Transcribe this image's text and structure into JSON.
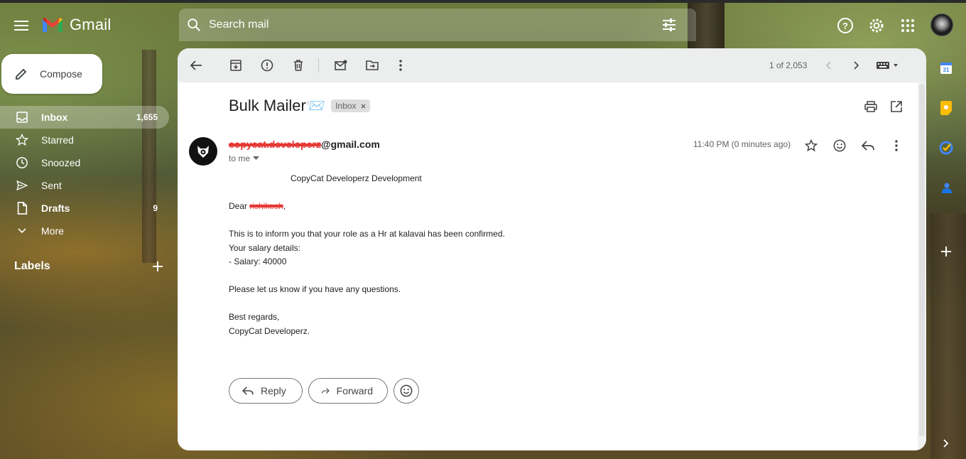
{
  "app": {
    "name": "Gmail"
  },
  "search": {
    "placeholder": "Search mail"
  },
  "sidebar": {
    "compose_label": "Compose",
    "items": [
      {
        "label": "Inbox",
        "count": "1,655"
      },
      {
        "label": "Starred",
        "count": ""
      },
      {
        "label": "Snoozed",
        "count": ""
      },
      {
        "label": "Sent",
        "count": ""
      },
      {
        "label": "Drafts",
        "count": "9"
      },
      {
        "label": "More",
        "count": ""
      }
    ],
    "labels_heading": "Labels"
  },
  "toolbar": {
    "pager_text": "1 of 2,053"
  },
  "message": {
    "subject": "Bulk Mailer📨",
    "label_chip": "Inbox",
    "sender_redacted": "copycat.developerz",
    "sender_domain": "@gmail.com",
    "to_line": "to me",
    "timestamp": "11:40 PM (0 minutes ago)",
    "body": {
      "header_line": "CopyCat Developerz Development",
      "greeting_prefix": "Dear ",
      "greeting_name_redacted": "rishikesh",
      "greeting_suffix": ",",
      "line1": "This is to inform you that your role as a Hr at kalavai has been confirmed.",
      "line2": "Your salary details:",
      "line3": "- Salary: 40000",
      "line4": "Please let us know if you have any questions.",
      "line5": "Best regards,",
      "line6": "CopyCat Developerz."
    }
  },
  "actions": {
    "reply_label": "Reply",
    "forward_label": "Forward"
  },
  "colors": {
    "gmail_red": "#ea4335",
    "gmail_blue": "#4285f4",
    "gmail_green": "#34a853",
    "gmail_yellow": "#fbbc04",
    "redaction": "#e53935"
  },
  "icons": {
    "top": [
      "menu-icon",
      "search-icon",
      "tune-icon",
      "help-icon",
      "settings-icon",
      "apps-icon"
    ],
    "toolbar": [
      "back-arrow-icon",
      "archive-icon",
      "report-spam-icon",
      "delete-icon",
      "mark-unread-icon",
      "move-to-icon",
      "more-vert-icon",
      "chevron-left-icon",
      "chevron-right-icon",
      "keyboard-icon"
    ],
    "right_panel": [
      "calendar-icon",
      "keep-icon",
      "tasks-icon",
      "contacts-icon",
      "add-icon",
      "expand-icon"
    ]
  }
}
